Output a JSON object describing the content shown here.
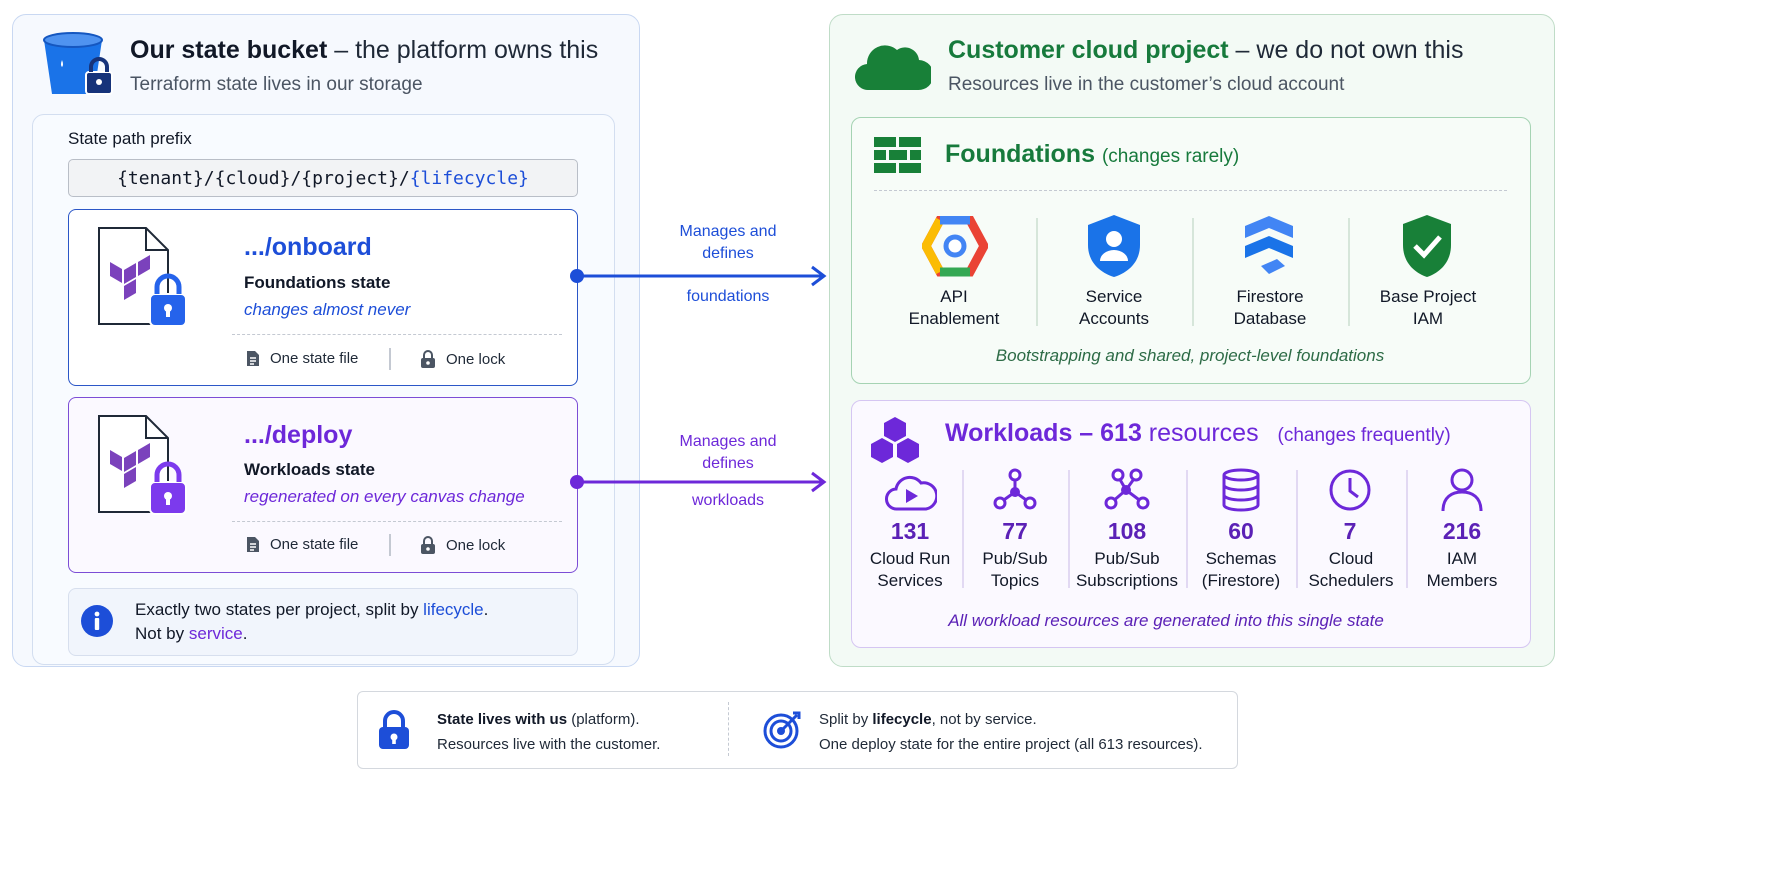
{
  "left_panel": {
    "title_bold": "Our state bucket",
    "title_rest": " – the platform owns this",
    "subtitle": "Terraform state lives in our storage",
    "path_label": "State path prefix",
    "path_prefix": "{tenant}/{cloud}/{project}/",
    "path_lifecycle": "{lifecycle}",
    "onboard": {
      "title": ".../onboard",
      "state": "Foundations state",
      "note": "changes almost never",
      "file": "One state file",
      "lock": "One lock"
    },
    "deploy": {
      "title": ".../deploy",
      "state": "Workloads state",
      "note": "regenerated on every canvas change",
      "file": "One state file",
      "lock": "One lock"
    },
    "info": {
      "line1_pre": "Exactly two states per project, split by ",
      "line1_hl": "lifecycle",
      "line1_post": ".",
      "line2_pre": "Not by ",
      "line2_hl": "service",
      "line2_post": "."
    }
  },
  "connectors": {
    "top": {
      "line1": "Manages and",
      "line2": "defines",
      "line3": "foundations"
    },
    "bottom": {
      "line1": "Manages and",
      "line2": "defines",
      "line3": "workloads"
    }
  },
  "right_panel": {
    "title_bold": "Customer cloud project",
    "title_rest": " – we do not own this",
    "subtitle": "Resources live in the customer’s cloud account",
    "foundations": {
      "title": "Foundations",
      "paren": "(changes rarely)",
      "items": [
        {
          "l1": "API",
          "l2": "Enablement",
          "icon": "api-enablement-icon"
        },
        {
          "l1": "Service",
          "l2": "Accounts",
          "icon": "service-accounts-icon"
        },
        {
          "l1": "Firestore",
          "l2": "Database",
          "icon": "firestore-icon"
        },
        {
          "l1": "Base Project",
          "l2": "IAM",
          "icon": "shield-check-icon"
        }
      ],
      "caption": "Bootstrapping and shared, project-level foundations"
    },
    "workloads": {
      "title_pre": "Workloads – ",
      "title_num": "613",
      "title_post": " resources",
      "paren": "(changes frequently)",
      "items": [
        {
          "num": "131",
          "l1": "Cloud Run",
          "l2": "Services",
          "icon": "cloud-run-icon"
        },
        {
          "num": "77",
          "l1": "Pub/Sub",
          "l2": "Topics",
          "icon": "pubsub-topics-icon"
        },
        {
          "num": "108",
          "l1": "Pub/Sub",
          "l2": "Subscriptions",
          "icon": "pubsub-subscriptions-icon"
        },
        {
          "num": "60",
          "l1": "Schemas",
          "l2": "(Firestore)",
          "icon": "database-icon"
        },
        {
          "num": "7",
          "l1": "Cloud",
          "l2": "Schedulers",
          "icon": "clock-icon"
        },
        {
          "num": "216",
          "l1": "IAM",
          "l2": "Members",
          "icon": "user-icon"
        }
      ],
      "caption": "All workload resources are generated into this single state"
    }
  },
  "bottom": {
    "left_bold": "State lives with us",
    "left_rest": " (platform).",
    "left_line2": "Resources live with the customer.",
    "right_pre": "Split by ",
    "right_bold": "lifecycle",
    "right_post": ", not by service.",
    "right_line2": "One deploy state for the entire project (all 613 resources)."
  },
  "colors": {
    "blue": "#1d4ed8",
    "purple": "#6d28d9",
    "green": "#177a3c",
    "terraform": "#7b42bc"
  }
}
